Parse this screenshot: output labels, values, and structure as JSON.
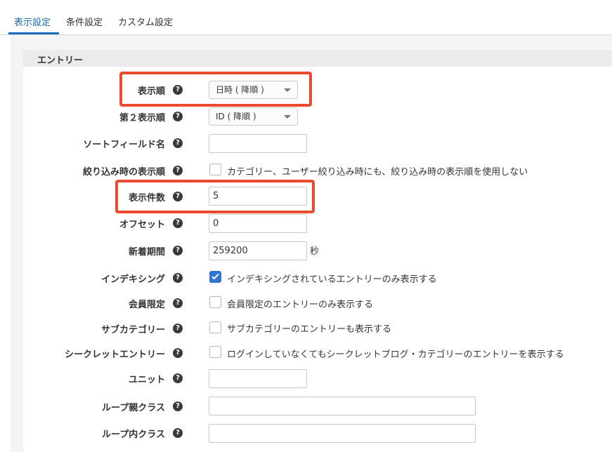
{
  "tabs": [
    {
      "label": "表示設定",
      "active": true
    },
    {
      "label": "条件設定",
      "active": false
    },
    {
      "label": "カスタム設定",
      "active": false
    }
  ],
  "section": {
    "title": "エントリー"
  },
  "help_glyph": "?",
  "fields": {
    "order": {
      "label": "表示順",
      "value": "日時 ( 降順 )"
    },
    "order2": {
      "label": "第２表示順",
      "value": "ID ( 降順 )"
    },
    "sort_field": {
      "label": "ソートフィールド名",
      "value": ""
    },
    "narrow_order": {
      "label": "絞り込み時の表示順",
      "checkbox_label": "カテゴリー、ユーザー絞り込み時にも、絞り込み時の表示順を使用しない",
      "checked": false
    },
    "limit": {
      "label": "表示件数",
      "value": "5"
    },
    "offset": {
      "label": "オフセット",
      "value": "0"
    },
    "new_period": {
      "label": "新着期間",
      "value": "259200",
      "unit": "秒"
    },
    "indexing": {
      "label": "インデキシング",
      "checkbox_label": "インデキシングされているエントリーのみ表示する",
      "checked": true
    },
    "members_only": {
      "label": "会員限定",
      "checkbox_label": "会員限定のエントリーのみ表示する",
      "checked": false
    },
    "subcategory": {
      "label": "サブカテゴリー",
      "checkbox_label": "サブカテゴリーのエントリーも表示する",
      "checked": false
    },
    "secret": {
      "label": "シークレットエントリー",
      "checkbox_label": "ログインしていなくてもシークレットブログ・カテゴリーのエントリーを表示する",
      "checked": false
    },
    "unit": {
      "label": "ユニット",
      "value": ""
    },
    "loop_parent_class": {
      "label": "ループ親クラス",
      "value": ""
    },
    "loop_inner_class": {
      "label": "ループ内クラス",
      "value": ""
    }
  },
  "colors": {
    "accent": "#1a6bb8",
    "highlight": "#ea4a2d",
    "checkbox_checked": "#2f74d0"
  }
}
